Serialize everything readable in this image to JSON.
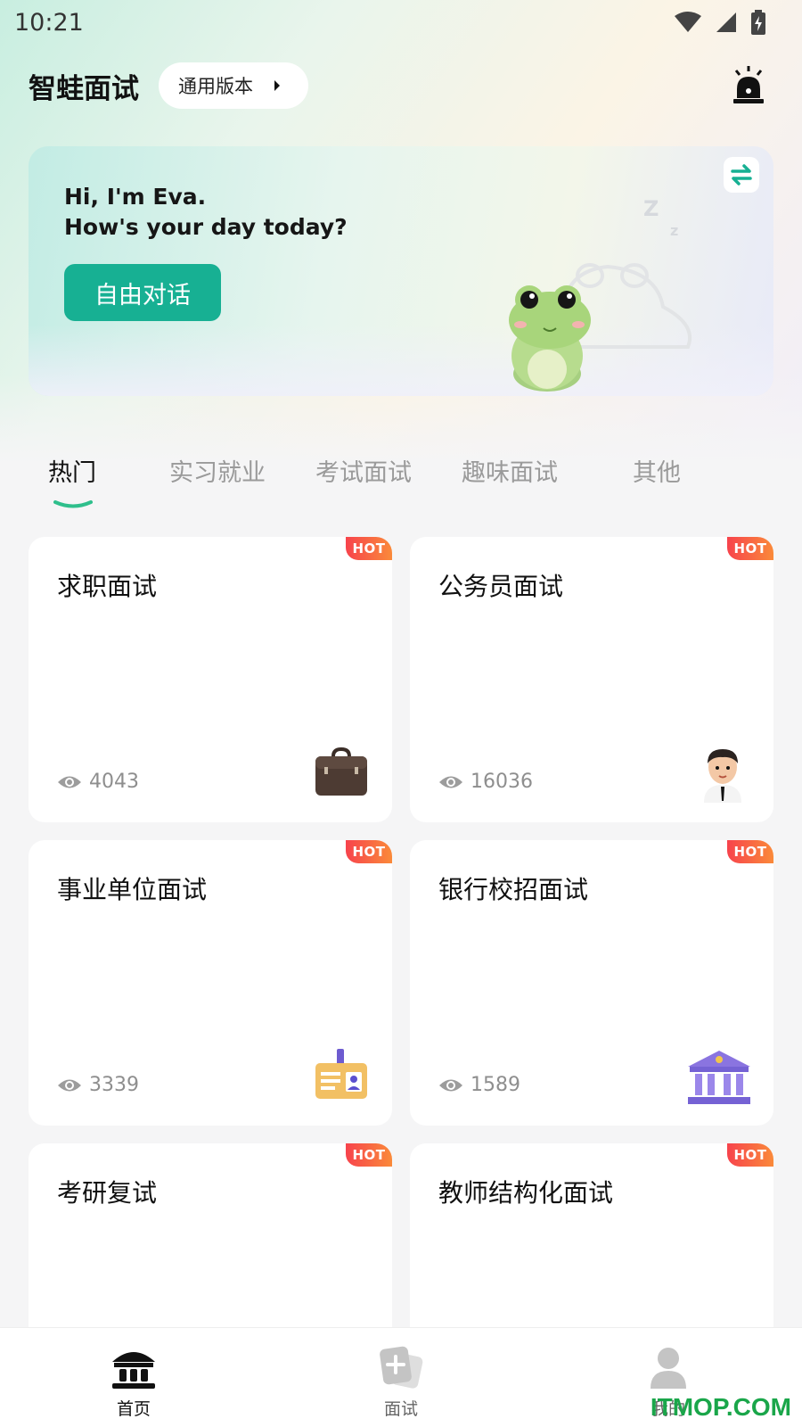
{
  "status_bar": {
    "time": "10:21"
  },
  "header": {
    "title": "智蛙面试",
    "version_label": "通用版本"
  },
  "hero": {
    "greeting_line1": "Hi, I'm Eva.",
    "greeting_line2": "How's your day today?",
    "button_label": "自由对话"
  },
  "tabs": [
    {
      "label": "热门",
      "active": true
    },
    {
      "label": "实习就业",
      "active": false
    },
    {
      "label": "考试面试",
      "active": false
    },
    {
      "label": "趣味面试",
      "active": false
    },
    {
      "label": "其他",
      "active": false
    }
  ],
  "cards": [
    {
      "title": "求职面试",
      "badge": "HOT",
      "views": "4043",
      "icon": "briefcase-icon"
    },
    {
      "title": "公务员面试",
      "badge": "HOT",
      "views": "16036",
      "icon": "man-avatar-icon"
    },
    {
      "title": "事业单位面试",
      "badge": "HOT",
      "views": "3339",
      "icon": "id-card-icon"
    },
    {
      "title": "银行校招面试",
      "badge": "HOT",
      "views": "1589",
      "icon": "bank-icon"
    },
    {
      "title": "考研复试",
      "badge": "HOT"
    },
    {
      "title": "教师结构化面试",
      "badge": "HOT"
    }
  ],
  "bottom_nav": [
    {
      "label": "首页",
      "icon": "home-bank-icon",
      "active": true
    },
    {
      "label": "面试",
      "icon": "interview-card-icon",
      "active": false
    },
    {
      "label": "我的",
      "icon": "profile-icon",
      "active": false
    }
  ],
  "watermark": "ITMOP.COM",
  "colors": {
    "accent_green": "#17b093",
    "hot_badge": "#f7434c",
    "inactive_text": "#9a9a9a"
  }
}
